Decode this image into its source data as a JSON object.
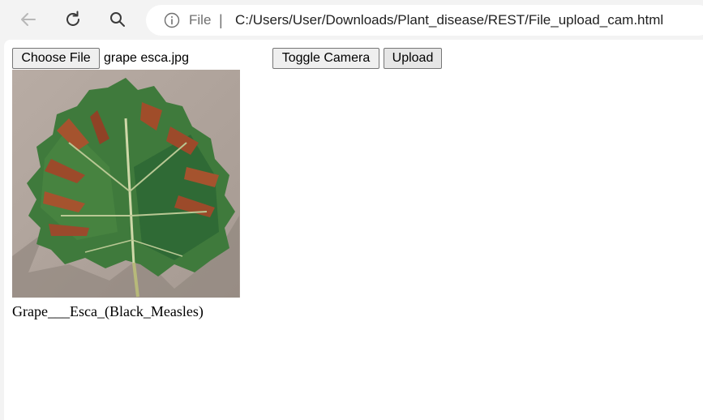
{
  "browser": {
    "back_icon": "back-arrow-icon",
    "refresh_icon": "refresh-icon",
    "search_icon": "search-icon",
    "info_icon": "info-icon",
    "file_label": "File",
    "separator": "|",
    "url": "C:/Users/User/Downloads/Plant_disease/REST/File_upload_cam.html"
  },
  "form": {
    "choose_file_label": "Choose File",
    "selected_file": "grape esca.jpg",
    "toggle_camera_label": "Toggle Camera",
    "upload_label": "Upload"
  },
  "result": {
    "image_subject": "grape leaf with esca disease",
    "prediction": "Grape___Esca_(Black_Measles)"
  },
  "colors": {
    "chrome_background": "#f3f3f3",
    "page_background": "#ffffff",
    "button_background": "#efefef",
    "button_border": "#767676"
  }
}
